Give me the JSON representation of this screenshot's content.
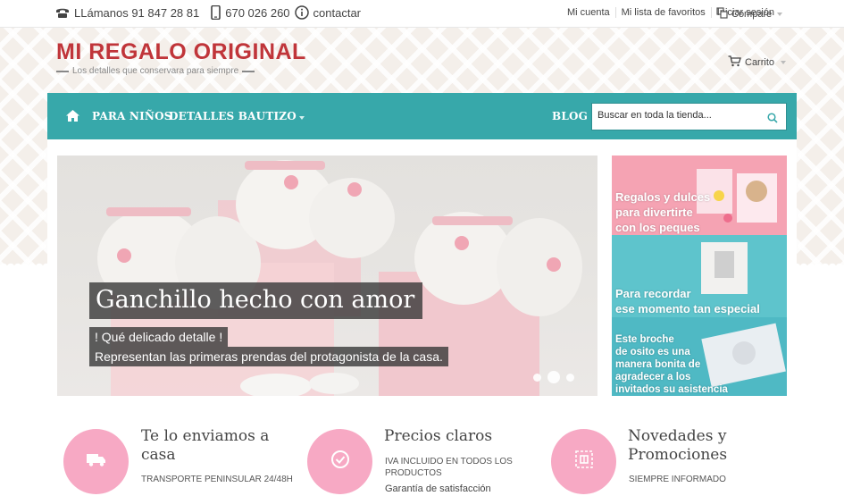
{
  "topbar": {
    "phone_label": "LLámanos 91 847 28 81",
    "mobile": "670 026 260",
    "contact": "contactar",
    "links": [
      "Mi cuenta",
      "Mi lista de favoritos",
      "Iniciar sesión"
    ],
    "compare": "Compare"
  },
  "header": {
    "logo_title": "MI REGALO ORIGINAL",
    "logo_subtitle": "Los detalles que conservara para siempre",
    "cart": "Carrito"
  },
  "nav": {
    "items": [
      "PARA NIÑOS",
      "DETALLES BAUTIZO",
      "BLOG"
    ],
    "search_placeholder": "Buscar en toda la tienda..."
  },
  "slider": {
    "caption": "Ganchillo hecho con amor",
    "line1": "! Qué delicado detalle !",
    "line2": "Representan las primeras prendas del protagonista de la casa.",
    "slide_count": 3,
    "active_slide": 2
  },
  "promo": {
    "block1": [
      "Regalos y dulces",
      "para divertirte",
      "con los peques"
    ],
    "block2": [
      "Para recordar",
      "ese momento tan especial"
    ],
    "block3": [
      "Este broche",
      "de osito es una",
      "manera bonita de",
      "agradecer a los",
      "invitados su asistencia"
    ]
  },
  "features": [
    {
      "title": "Te lo enviamos a casa",
      "desc": "TRANSPORTE PENINSULAR 24/48H",
      "extra": "",
      "icon": "truck-icon"
    },
    {
      "title": "Precios claros",
      "desc": "IVA INCLUIDO EN TODOS LOS PRODUCTOS",
      "extra": "Garantía de satisfacción",
      "icon": "check-circle-icon"
    },
    {
      "title": "Novedades y Promociones",
      "desc": "SIEMPRE INFORMADO",
      "extra": "",
      "icon": "gift-box-icon"
    }
  ],
  "colors": {
    "brand_red": "#c0353a",
    "nav_teal": "#37a8aa",
    "feature_pink": "#f7a9c4"
  }
}
